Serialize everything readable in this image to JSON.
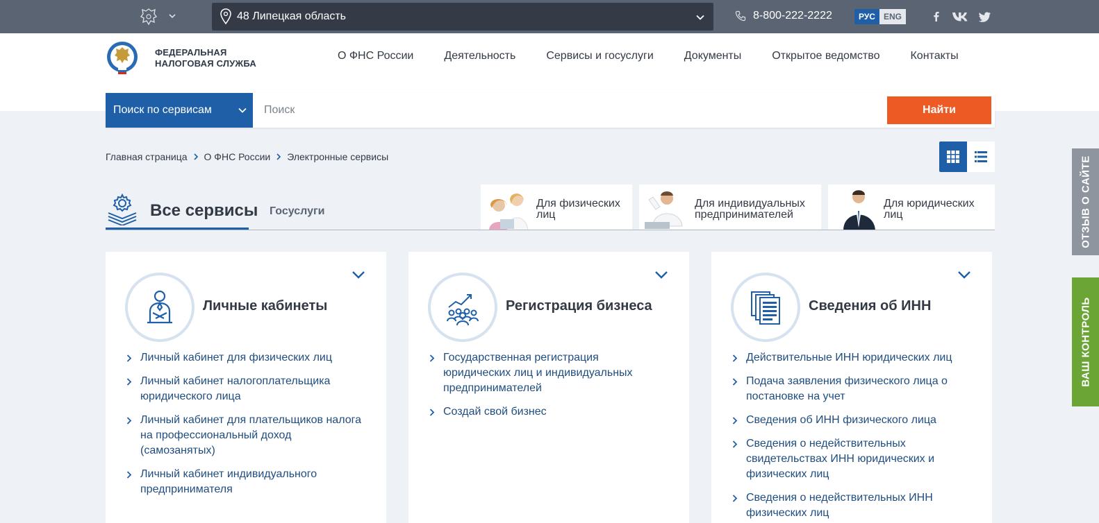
{
  "topbar": {
    "region": "48 Липецкая область",
    "phone": "8-800-222-2222",
    "lang_ru": "РУС",
    "lang_en": "ENG",
    "social": [
      "facebook-icon",
      "vk-icon",
      "twitter-icon"
    ],
    "bg_color": "#5b6473"
  },
  "header": {
    "logo_line1": "ФЕДЕРАЛЬНАЯ",
    "logo_line2": "НАЛОГОВАЯ СЛУЖБА",
    "nav": [
      {
        "label": "О ФНС России"
      },
      {
        "label": "Деятельность"
      },
      {
        "label": "Сервисы и госуслуги"
      },
      {
        "label": "Документы"
      },
      {
        "label": "Открытое ведомство"
      },
      {
        "label": "Контакты"
      }
    ]
  },
  "search": {
    "scope": "Поиск по сервисам",
    "placeholder": "Поиск",
    "button": "Найти"
  },
  "breadcrumb": [
    "Главная страница",
    "О ФНС России",
    "Электронные сервисы"
  ],
  "tabs": {
    "all": "Все сервисы",
    "gos": "Госуслуги"
  },
  "audiences": [
    {
      "line1": "Для физических",
      "line2": "лиц"
    },
    {
      "line1": "Для индивидуальных",
      "line2": "предпринимателей"
    },
    {
      "line1": "Для юридических",
      "line2": "лиц"
    }
  ],
  "cards": [
    {
      "title": "Личные кабинеты",
      "links": [
        "Личный кабинет для физических лиц",
        "Личный кабинет налогоплательщика юридического лица",
        "Личный кабинет для плательщиков налога на профессиональный доход (самозанятых)",
        "Личный кабинет индивидуального предпринимателя"
      ]
    },
    {
      "title": "Регистрация бизнеса",
      "links": [
        "Государственная регистрация юридических лиц и индивидуальных предпринимателей",
        "Создай свой бизнес"
      ]
    },
    {
      "title": "Сведения об ИНН",
      "links": [
        "Действительные ИНН юридических лиц",
        "Подача заявления физического лица о постановке на учет",
        "Сведения об ИНН физического лица",
        "Сведения о недействительных свидетельствах ИНН юридических и физических лиц",
        "Сведения о недействительных ИНН физических лиц"
      ]
    }
  ],
  "side": {
    "feedback": "ОТЗЫВ О САЙТЕ",
    "control": "ВАШ КОНТРОЛЬ"
  },
  "colors": {
    "accent": "#1f5fa8",
    "button": "#ee5a24",
    "feedback_tab": "#8e959f",
    "control_tab": "#6aa535"
  }
}
